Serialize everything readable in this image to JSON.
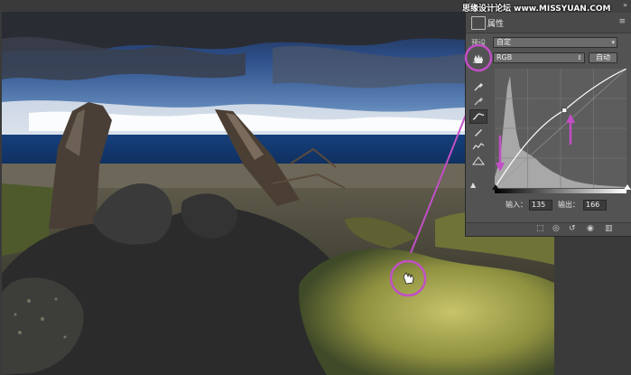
{
  "watermark": "思缘设计论坛 www.MISSYUAN.COM",
  "panel": {
    "tab_label": "属性",
    "close_glyph": "✕",
    "collapse_glyph": "»",
    "menu_glyph": "≡",
    "preset_label": "预设",
    "preset_value": "自定",
    "channel_value": "RGB",
    "auto_button": "自动",
    "input_label": "输入：",
    "input_value": "135",
    "output_label": "输出：",
    "output_value": "166"
  },
  "curve": {
    "point_in": 135,
    "point_out": 166,
    "range": [
      0,
      255
    ]
  },
  "colors": {
    "annotation": "#c24fc6",
    "panel_bg": "#535353",
    "graph_bg": "#5d5d5d"
  },
  "icons": {
    "hand_tool": "hand-icon",
    "eyedropper": "eyedropper-icon",
    "curve_tool": "curve-icon",
    "pencil": "pencil-icon"
  }
}
